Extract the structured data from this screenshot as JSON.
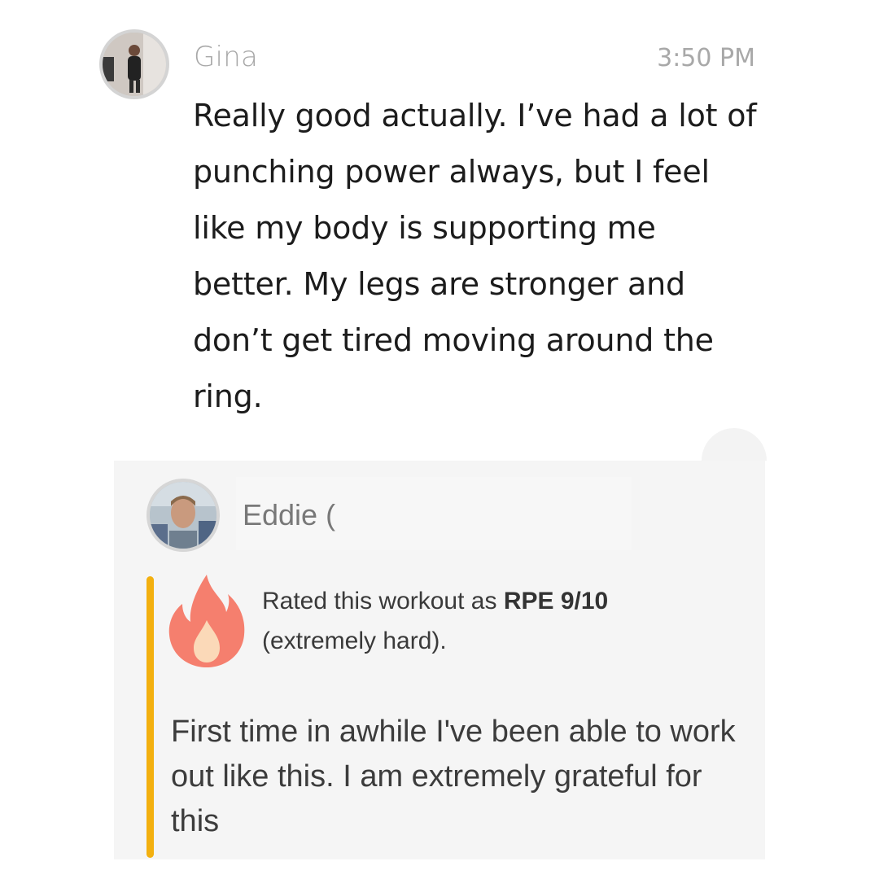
{
  "top_message": {
    "sender": "Gina",
    "time": "3:50 PM",
    "text": "Really good actually. I’ve had a lot of punching power always, but I feel like my body is supporting me better. My legs are stronger and don’t get tired moving around the ring."
  },
  "bottom_message": {
    "sender": "Eddie (",
    "rating_prefix": "Rated this workout as ",
    "rating_value": "RPE 9/10",
    "rating_suffix": "(extremely hard).",
    "comment": "First time in awhile I've been able to work out like this. I am extremely grateful for this"
  },
  "colors": {
    "accent_bar": "#f3b00f",
    "flame_outer": "#f57f6e",
    "flame_inner": "#fbd9b8"
  },
  "icons": {
    "rating": "fire-icon"
  }
}
